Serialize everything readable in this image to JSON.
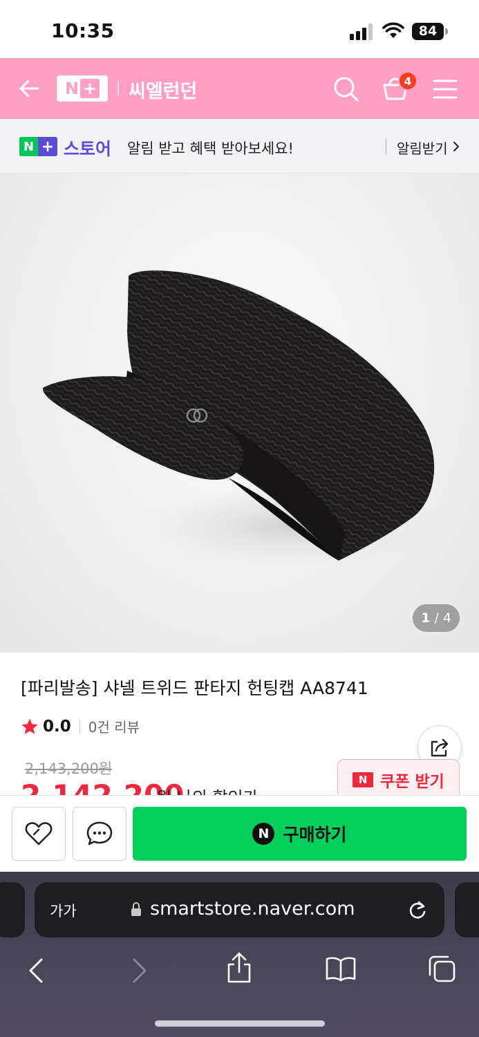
{
  "status_bar": {
    "time": "10:35",
    "battery": "84"
  },
  "header": {
    "logo_n": "N",
    "logo_plus": "+",
    "shop_name": "씨엘런던",
    "cart_count": "4",
    "theme_color": "#ff9fc4"
  },
  "notice": {
    "badge_n": "N",
    "badge_plus": "+",
    "store_label": "스토어",
    "message": "알림 받고 혜택 받아보세요!",
    "action": "알림받기"
  },
  "gallery": {
    "current": "1",
    "separator": " / ",
    "total": "4"
  },
  "product": {
    "title": "[파리발송] 샤넬 트위드 판타지 헌팅캡 AA8741",
    "rating": "0.0",
    "review_count": "0건 리뷰",
    "original_price": "2,143,200원",
    "sale_price": "2,142,200",
    "sale_suffix": "원 나의 할인가 ⌄",
    "coupon_icon": "N",
    "coupon_label": "쿠폰 받기",
    "sale_color": "#f0273e"
  },
  "actions": {
    "buy_icon": "N",
    "buy_label": "구매하기",
    "buy_color": "#03cf5d"
  },
  "browser": {
    "text_size": "가가",
    "url": "smartstore.naver.com"
  }
}
